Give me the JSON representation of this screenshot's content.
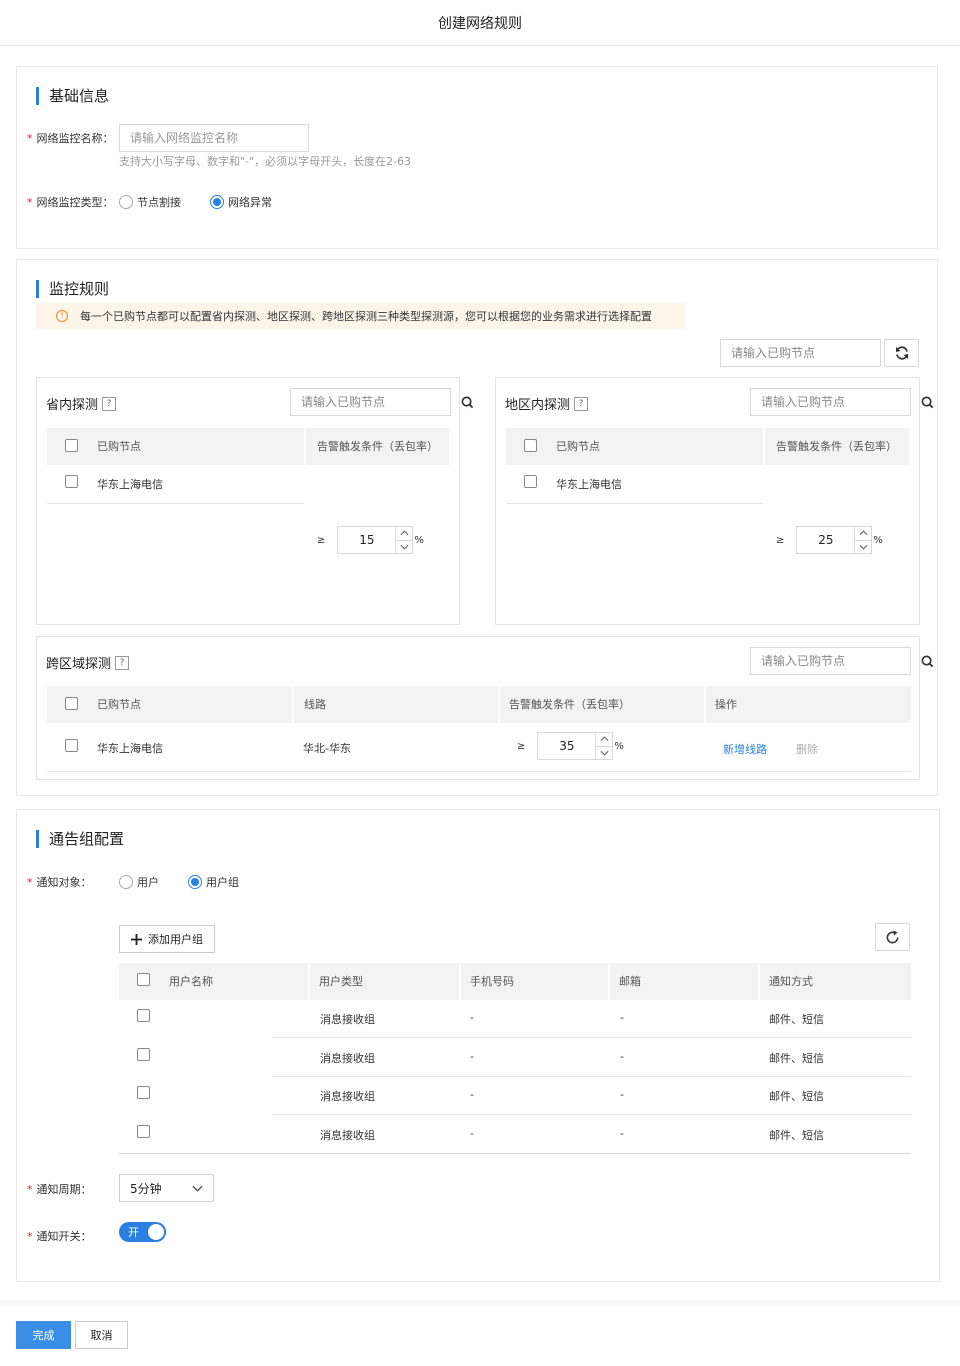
{
  "page": {
    "title": "创建网络规则",
    "accent": "#2b7fe0"
  },
  "basic": {
    "section_title": "基础信息",
    "name_label": "网络监控名称：",
    "name_placeholder": "请输入网络监控名称",
    "name_hint": "支持大小写字母、数字和\"-\"，必须以字母开头，长度在2-63",
    "type_label": "网络监控类型：",
    "type_options": [
      {
        "label": "节点割接",
        "selected": false
      },
      {
        "label": "网络异常",
        "selected": true
      }
    ]
  },
  "rule": {
    "section_title": "监控规则",
    "notice": "每一个已购节点都可以配置省内探测、地区探测、跨地区探测三种类型探测源，您可以根据您的业务需求进行选择配置",
    "search_placeholder": "请输入已购节点",
    "province": {
      "title": "省内探测",
      "help": "?",
      "search_placeholder": "请输入已购节点",
      "columns": [
        "已购节点",
        "告警触发条件（丢包率）"
      ],
      "rows": [
        {
          "node": "华东上海电信"
        }
      ],
      "ge": "≥",
      "threshold": "15",
      "unit": "%"
    },
    "region": {
      "title": "地区内探测",
      "help": "?",
      "search_placeholder": "请输入已购节点",
      "columns": [
        "已购节点",
        "告警触发条件（丢包率）"
      ],
      "rows": [
        {
          "node": "华东上海电信"
        }
      ],
      "ge": "≥",
      "threshold": "25",
      "unit": "%"
    },
    "cross": {
      "title": "跨区域探测",
      "help": "?",
      "search_placeholder": "请输入已购节点",
      "columns": [
        "已购节点",
        "线路",
        "告警触发条件（丢包率）",
        "操作"
      ],
      "rows": [
        {
          "node": "华东上海电信",
          "line": "华北-华东",
          "ge": "≥",
          "threshold": "35",
          "unit": "%",
          "add_link": "新增线路",
          "delete_link": "删除"
        }
      ]
    }
  },
  "notify": {
    "section_title": "通告组配置",
    "target_label": "通知对象：",
    "target_options": [
      {
        "label": "用户",
        "selected": false
      },
      {
        "label": "用户组",
        "selected": true
      }
    ],
    "add_group_label": "添加用户组",
    "columns": [
      "用户名称",
      "用户类型",
      "手机号码",
      "邮箱",
      "通知方式"
    ],
    "rows": [
      {
        "name": "",
        "type": "消息接收组",
        "phone": "-",
        "email": "-",
        "method": "邮件、短信"
      },
      {
        "name": "",
        "type": "消息接收组",
        "phone": "-",
        "email": "-",
        "method": "邮件、短信"
      },
      {
        "name": "",
        "type": "消息接收组",
        "phone": "-",
        "email": "-",
        "method": "邮件、短信"
      },
      {
        "name": "",
        "type": "消息接收组",
        "phone": "-",
        "email": "-",
        "method": "邮件、短信"
      }
    ],
    "period_label": "通知周期：",
    "period_value": "5分钟",
    "switch_label": "通知开关：",
    "switch_value": "开"
  },
  "footer": {
    "confirm_label": "完成",
    "cancel_label": "取消"
  }
}
